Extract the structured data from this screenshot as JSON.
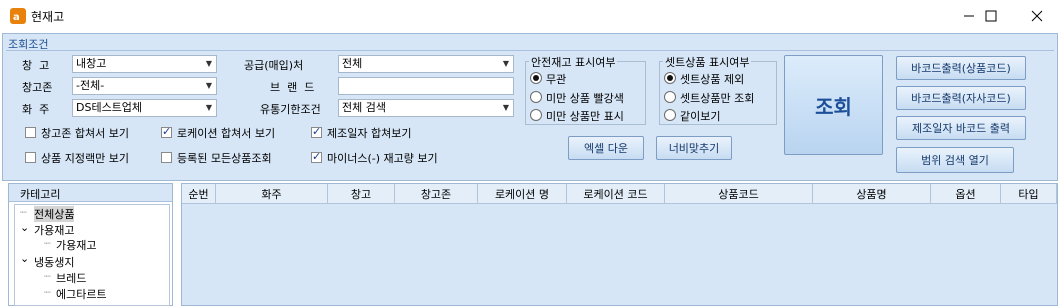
{
  "window": {
    "title": "현재고"
  },
  "conditions": {
    "title": "조회조건",
    "fields": {
      "warehouse": {
        "label": "창  고",
        "value": "내창고"
      },
      "zone": {
        "label": "창고존",
        "value": "-전체-"
      },
      "owner": {
        "label": "화  주",
        "value": "DS테스트업체"
      },
      "supplier": {
        "label": "공급(매입)처",
        "value": "전체"
      },
      "brand": {
        "label": "브  랜  드",
        "value": ""
      },
      "expiry": {
        "label": "유통기한조건",
        "value": "전체 검색"
      }
    },
    "checkboxes": [
      {
        "label": "창고존 합쳐서 보기",
        "checked": false
      },
      {
        "label": "로케이션 합쳐서 보기",
        "checked": true
      },
      {
        "label": "제조일자 합쳐보기",
        "checked": true
      },
      {
        "label": "상품 지정랙만 보기",
        "checked": false
      },
      {
        "label": "등록된 모든상품조회",
        "checked": false
      },
      {
        "label": "마이너스(-) 재고량 보기",
        "checked": true
      }
    ],
    "safety_group": {
      "title": "안전재고 표시여부",
      "options": [
        "무관",
        "미만 상품 빨강색",
        "미만 상품만 표시"
      ],
      "selected": 0
    },
    "set_group": {
      "title": "셋트상품 표시여부",
      "options": [
        "셋트상품 제외",
        "셋트상품만 조회",
        "같이보기"
      ],
      "selected": 0
    },
    "buttons": {
      "excel": "엑셀 다운",
      "fit_width": "너비맞추기",
      "search": "조회",
      "barcode_product": "바코드출력(상품코드)",
      "barcode_company": "바코드출력(자사코드)",
      "barcode_mfg": "제조일자 바코드 출력",
      "range_search": "범위 검색 열기"
    }
  },
  "category": {
    "title": "카테고리",
    "tree": [
      "전체상품",
      "가용재고",
      "가용재고",
      "냉동생지",
      "브레드",
      "에그타르트"
    ]
  },
  "grid": {
    "columns": [
      "순번",
      "화주",
      "창고",
      "창고존",
      "로케이션 명",
      "로케이션 코드",
      "상품코드",
      "상품명",
      "옵션",
      "타입"
    ]
  }
}
